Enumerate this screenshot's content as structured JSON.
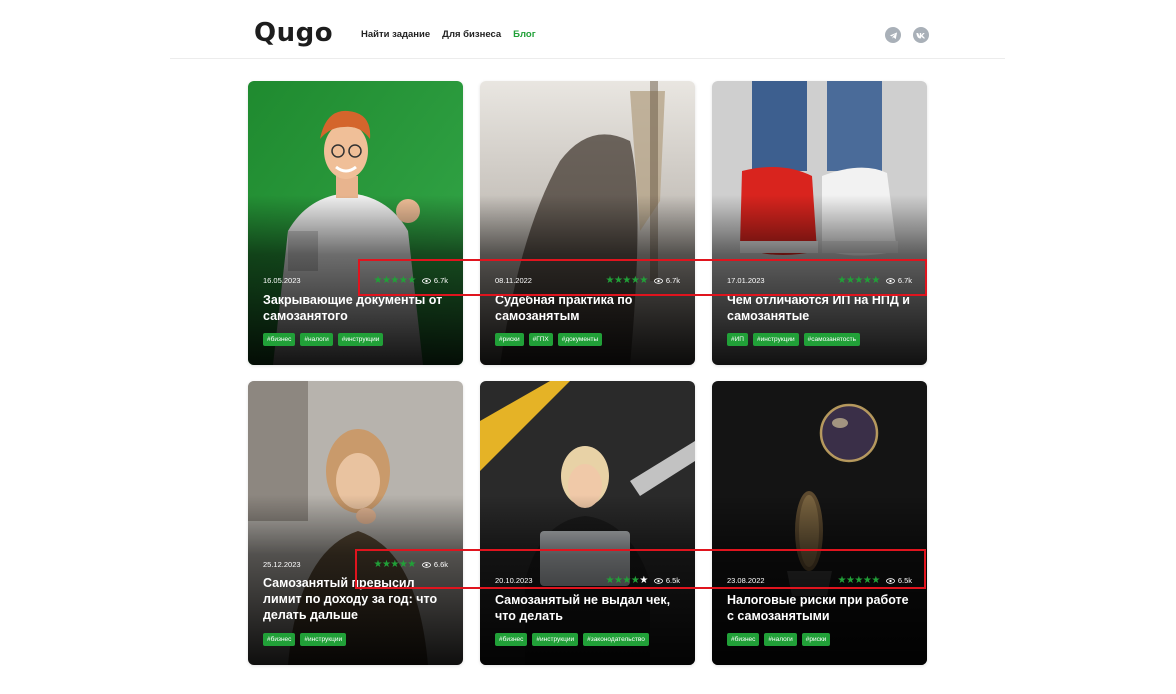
{
  "header": {
    "logo": "Qugo",
    "nav": [
      {
        "label": "Найти задание"
      },
      {
        "label": "Для бизнеса"
      },
      {
        "label": "Блог"
      }
    ],
    "social_icons": [
      "telegram-icon",
      "vk-icon"
    ]
  },
  "colors": {
    "accent": "#21a038",
    "highlight_box": "#e0141e"
  },
  "cards": [
    {
      "date": "16.05.2023",
      "rating": 5,
      "views": "6.7k",
      "title": "Закрывающие документы от самозанятого",
      "tags": [
        "#бизнес",
        "#налоги",
        "#инструкции"
      ]
    },
    {
      "date": "08.11.2022",
      "rating": 5,
      "views": "6.7k",
      "title": "Судебная практика по самозанятым",
      "tags": [
        "#риски",
        "#ГПХ",
        "#документы"
      ]
    },
    {
      "date": "17.01.2023",
      "rating": 5,
      "views": "6.7k",
      "title": "Чем отличаются ИП на НПД и самозанятые",
      "tags": [
        "#ИП",
        "#инструкции",
        "#самозанятость"
      ]
    },
    {
      "date": "25.12.2023",
      "rating": 5,
      "views": "6.6k",
      "title": "Самозанятый превысил лимит по доходу за год: что делать дальше",
      "tags": [
        "#бизнес",
        "#инструкции"
      ]
    },
    {
      "date": "20.10.2023",
      "rating": 4,
      "views": "6.5k",
      "title": "Самозанятый не выдал чек, что делать",
      "tags": [
        "#бизнес",
        "#инструкции",
        "#законодательство"
      ]
    },
    {
      "date": "23.08.2022",
      "rating": 5,
      "views": "6.5k",
      "title": "Налоговые риски при работе с самозанятыми",
      "tags": [
        "#бизнес",
        "#налоги",
        "#риски"
      ]
    }
  ]
}
